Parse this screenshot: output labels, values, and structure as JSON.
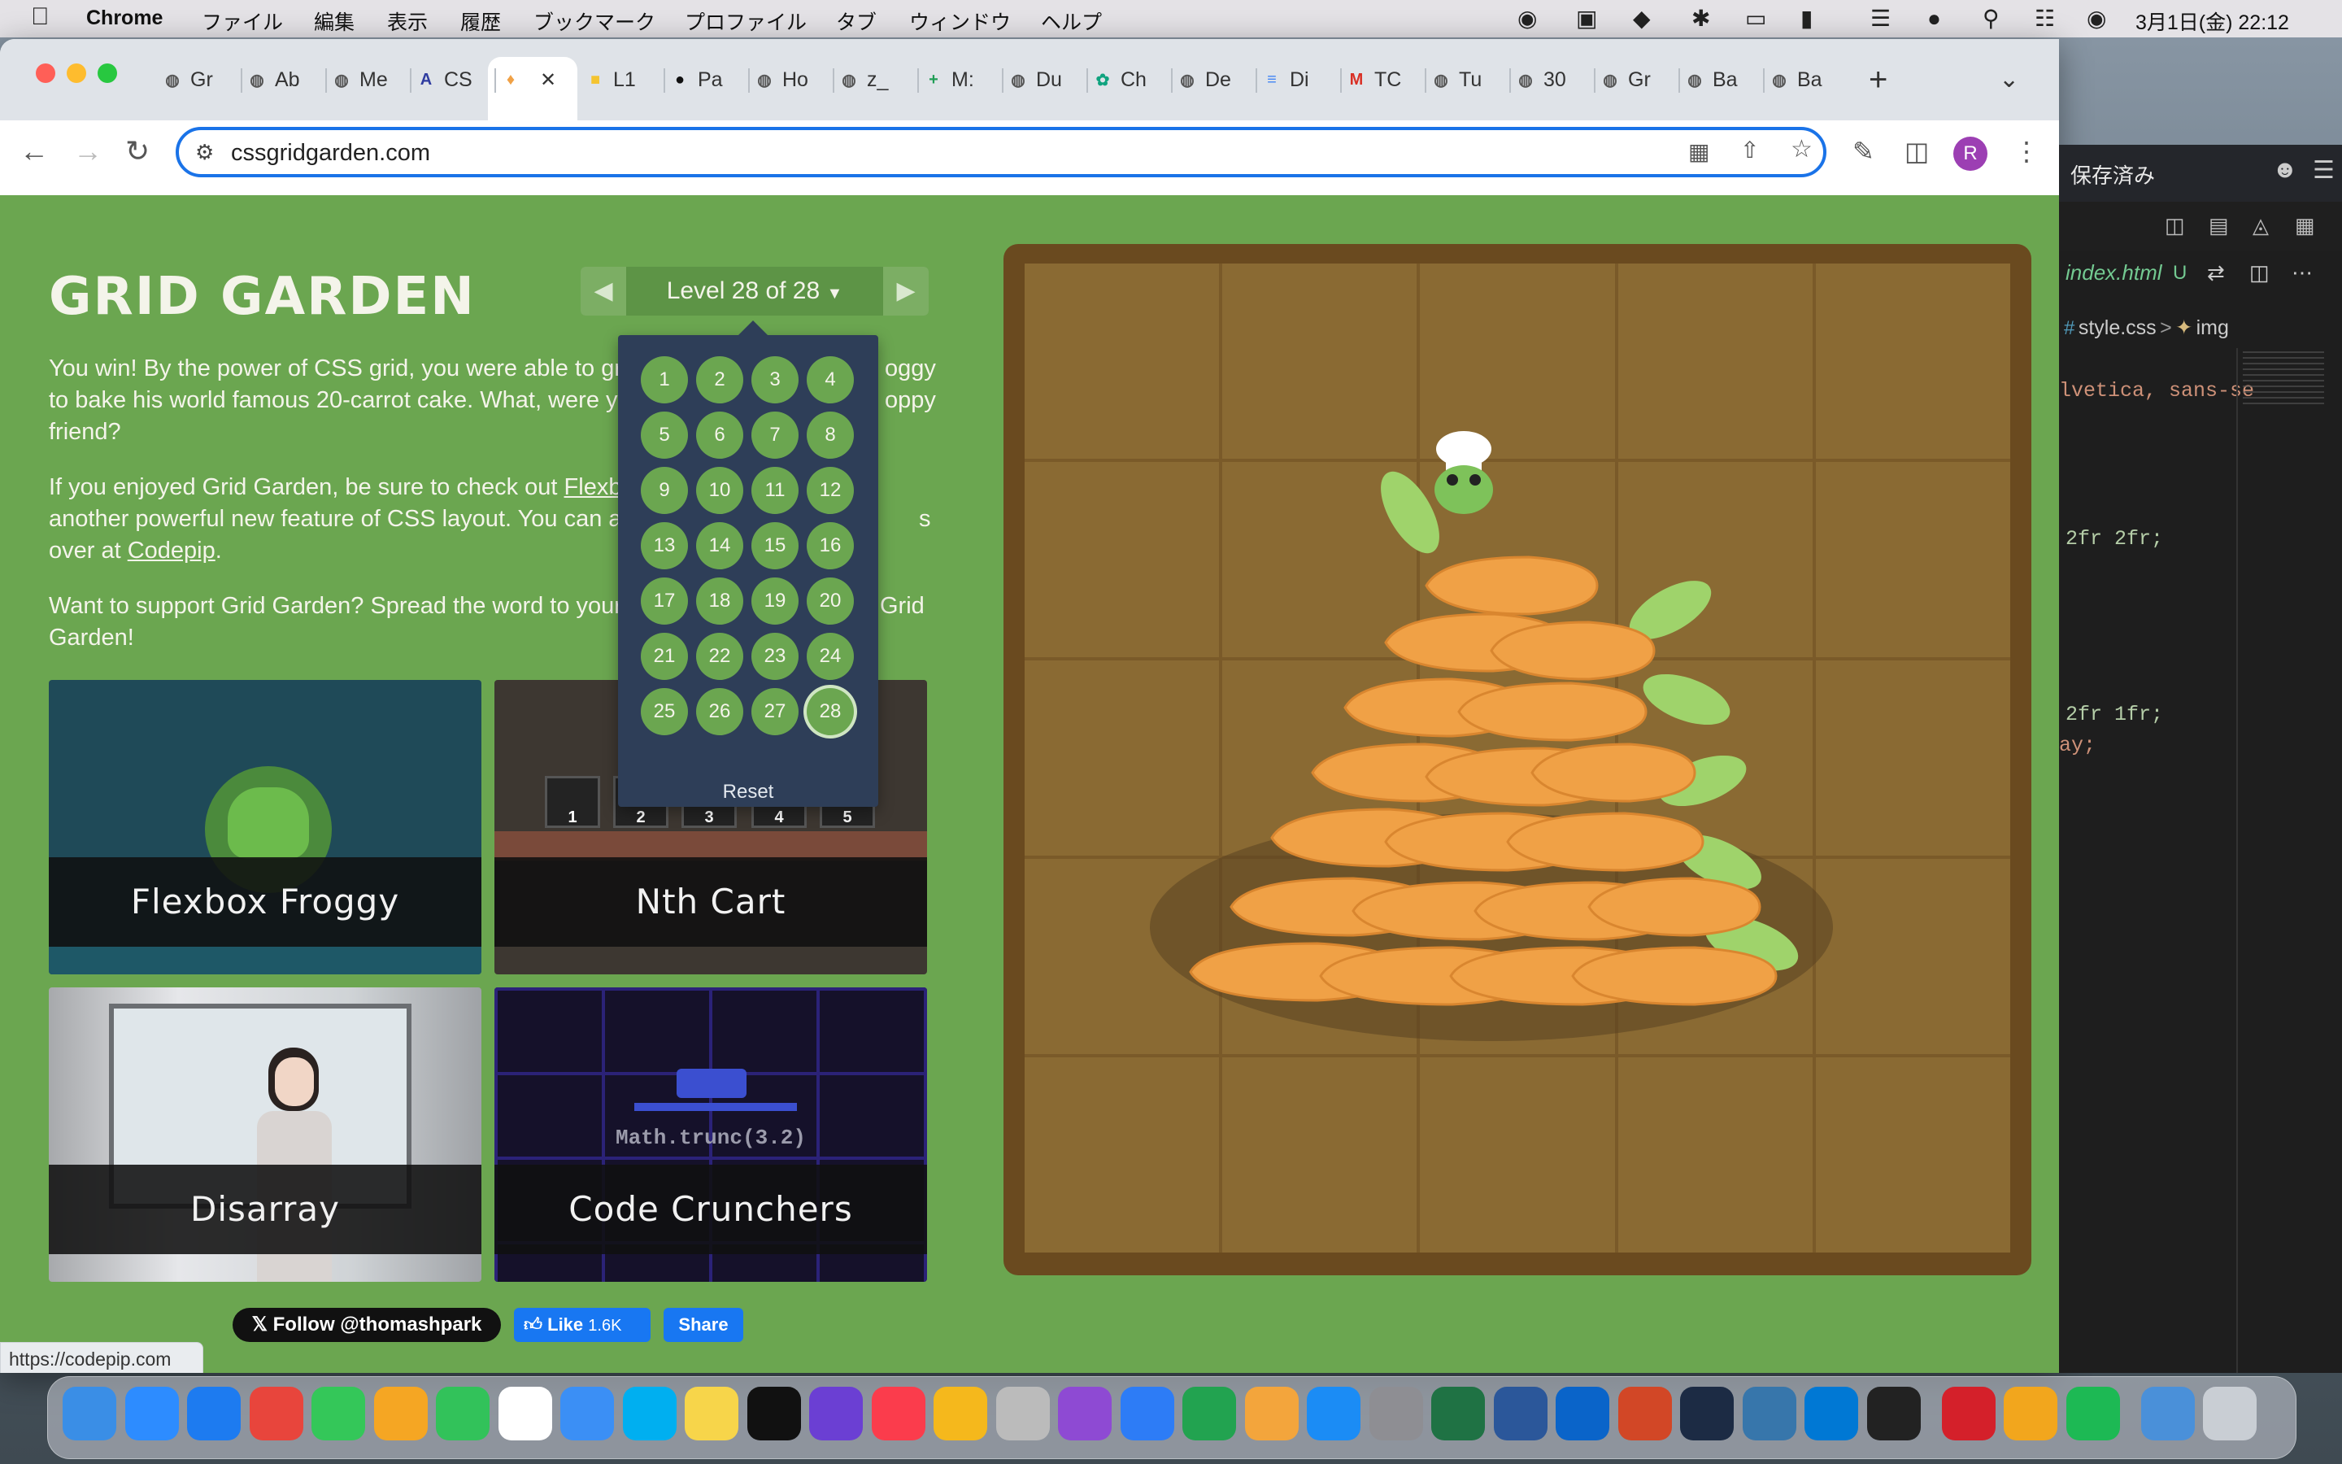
{
  "menubar": {
    "app": "Chrome",
    "items": [
      "ファイル",
      "編集",
      "表示",
      "履歴",
      "ブックマーク",
      "プロファイル",
      "タブ",
      "ウィンドウ",
      "ヘルプ"
    ],
    "clock": "3月1日(金)  22:12"
  },
  "tabs": [
    {
      "label": "Gr",
      "icon": "globe-icon"
    },
    {
      "label": "Ab",
      "icon": "globe-icon"
    },
    {
      "label": "Me",
      "icon": "globe-icon"
    },
    {
      "label": "CS",
      "icon": "css-icon"
    },
    {
      "label": "",
      "icon": "carrot-icon",
      "active": true
    },
    {
      "label": "L1",
      "icon": "folder-icon"
    },
    {
      "label": "Pa",
      "icon": "github-icon"
    },
    {
      "label": "Ho",
      "icon": "globe-icon"
    },
    {
      "label": "z_",
      "icon": "globe-icon"
    },
    {
      "label": "M:",
      "icon": "sheet-icon"
    },
    {
      "label": "Du",
      "icon": "globe-icon"
    },
    {
      "label": "Ch",
      "icon": "chatgpt-icon"
    },
    {
      "label": "De",
      "icon": "globe-icon"
    },
    {
      "label": "Di",
      "icon": "docs-icon"
    },
    {
      "label": "TC",
      "icon": "gmail-icon"
    },
    {
      "label": "Tu",
      "icon": "globe-icon"
    },
    {
      "label": "30",
      "icon": "globe-icon"
    },
    {
      "label": "Gr",
      "icon": "globe-icon"
    },
    {
      "label": "Ba",
      "icon": "globe-icon"
    },
    {
      "label": "Ba",
      "icon": "globe-icon"
    }
  ],
  "address": {
    "url": "cssgridgarden.com",
    "profile": "R"
  },
  "page": {
    "title": "GRID GARDEN",
    "level_label": "Level 28 of 28",
    "para1_a": "You win! By the power of CSS grid, you were able to gro",
    "para1_b": "oggy",
    "para1_c": "to bake his world famous 20-carrot cake. What, were yo",
    "para1_d": "oppy",
    "para1_e": "friend?",
    "para2_a": "If you enjoyed Grid Garden, be sure to check out ",
    "para2_link": "Flexbo",
    "para2_c": "another powerful new feature of CSS layout. You can al",
    "para2_d": "s",
    "para2_e": "over at ",
    "para2_link2": "Codepip",
    "para2_f": ".",
    "para3_a": "Want to support Grid Garden? Spread the word to your",
    "para3_b": "Grid",
    "para3_c": "Garden!",
    "levels": [
      "1",
      "2",
      "3",
      "4",
      "5",
      "6",
      "7",
      "8",
      "9",
      "10",
      "11",
      "12",
      "13",
      "14",
      "15",
      "16",
      "17",
      "18",
      "19",
      "20",
      "21",
      "22",
      "23",
      "24",
      "25",
      "26",
      "27",
      "28"
    ],
    "current_level": "28",
    "reset": "Reset",
    "cards": [
      {
        "title": "Flexbox Froggy"
      },
      {
        "title": "Nth Cart"
      },
      {
        "title": "Disarray"
      },
      {
        "title": "Code Crunchers"
      }
    ],
    "nth_cart_numbers": [
      "1",
      "2",
      "3",
      "4",
      "5"
    ],
    "code_crunchers_code": "Math.trunc(3.2)",
    "twitter": "Follow @thomashpark",
    "fb_like": "Like",
    "fb_like_count": "1.6K",
    "fb_share": "Share"
  },
  "status_url": "https://codepip.com",
  "editor": {
    "saved": "保存済み",
    "file": "index.html",
    "file_status": "U",
    "breadcrumb_a": "style.css",
    "breadcrumb_b": "img",
    "line1": "lvetica, sans-se",
    "line2": "2fr 2fr;",
    "line3": "2fr 1fr;",
    "line4": "ay;"
  },
  "colors": {
    "page_bg": "#6ba650",
    "dropdown": "#2e3e58",
    "soil": "#8a6a33",
    "carrot": "#f0a146"
  }
}
